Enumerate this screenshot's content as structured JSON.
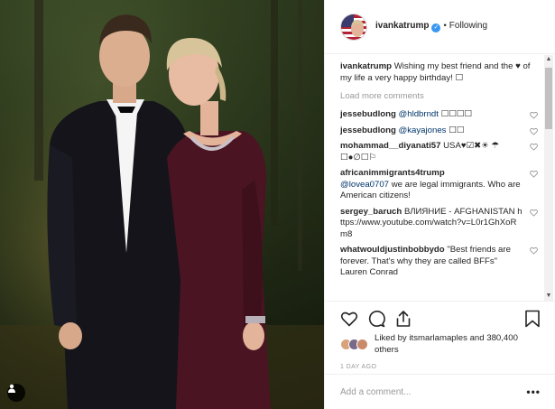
{
  "post": {
    "username": "ivankatrump",
    "follow_status": "Following",
    "separator": "•"
  },
  "caption": {
    "username": "ivankatrump",
    "text": "Wishing my best friend and the ♥ of my life a very happy birthday! ☐"
  },
  "load_more_label": "Load more comments",
  "comments": [
    {
      "username": "jessebudlong",
      "mention": "@hldbrndt",
      "text": "☐☐☐☐"
    },
    {
      "username": "jessebudlong",
      "mention": "@kayajones",
      "text": "☐☐"
    },
    {
      "username": "mohammad__diyanati57",
      "mention": "",
      "text": "USA♥☑✖☀ ☂☐●∅☐⚐"
    },
    {
      "username": "africanimmigrants4trump",
      "mention": "@lovea0707",
      "text": "we are legal immigrants. Who are American citizens!"
    },
    {
      "username": "sergey_baruch",
      "mention": "",
      "text": "ВЛИЯНИЕ - AFGHANISTAN https://www.youtube.com/watch?v=L0r1GhXoRm8"
    },
    {
      "username": "whatwouldjustinbobbydo",
      "mention": "",
      "text": "\"Best friends are forever. That's why they are called BFFs\" Lauren Conrad"
    }
  ],
  "likes": {
    "text": "Liked by itsmarlamaples and 380,400 others",
    "liked_by": "itsmarlamaples",
    "count": "380,400 others"
  },
  "time_ago": "1 DAY AGO",
  "add_comment_placeholder": "Add a comment...",
  "more_options_label": "•••",
  "scroll": {
    "up_arrow": "▲",
    "down_arrow": "▼"
  },
  "colors": {
    "verified": "#3897f0",
    "mention": "#003569",
    "muted": "#999999",
    "dress": "#4a1422",
    "suit": "#16161c"
  }
}
